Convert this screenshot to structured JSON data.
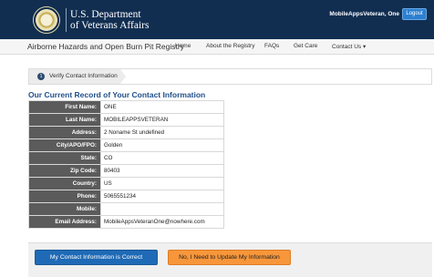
{
  "header": {
    "brand_line1": "U.S. Department",
    "brand_line2": "of Veterans Affairs",
    "user_name": "MobileAppsVeteran, One",
    "logout_label": "Logout"
  },
  "navbar": {
    "app_title": "Airborne Hazards and Open Burn Pit Registry",
    "items": [
      {
        "label": "Home"
      },
      {
        "label": "About the Registry"
      },
      {
        "label": "FAQs"
      },
      {
        "label": "Get Care"
      },
      {
        "label": "Contact Us ▾"
      }
    ]
  },
  "breadcrumb": {
    "step_number": "1",
    "step_label": "Verify Contact Information"
  },
  "section_title": "Our Current Record of Your Contact Information",
  "contact_rows": [
    {
      "label": "First Name:",
      "value": "ONE"
    },
    {
      "label": "Last Name:",
      "value": "MOBILEAPPSVETERAN"
    },
    {
      "label": "Address:",
      "value": "2 Noname St undefined"
    },
    {
      "label": "City/APO/FPO:",
      "value": "Golden"
    },
    {
      "label": "State:",
      "value": "CO"
    },
    {
      "label": "Zip Code:",
      "value": "80403"
    },
    {
      "label": "Country:",
      "value": "US"
    },
    {
      "label": "Phone:",
      "value": "5065551234"
    },
    {
      "label": "Mobile:",
      "value": ""
    },
    {
      "label": "Email Address:",
      "value": "MobileAppsVeteranOne@nowhere.com"
    }
  ],
  "buttons": {
    "correct_label": "My Contact Information is Correct",
    "update_label": "No, I Need to Update My Information"
  },
  "colors": {
    "header_bg": "#112e51",
    "section_title": "#20508b",
    "table_label_bg": "#5b5b5b",
    "primary_button": "#1f6ab6",
    "secondary_button": "#f7963a"
  }
}
